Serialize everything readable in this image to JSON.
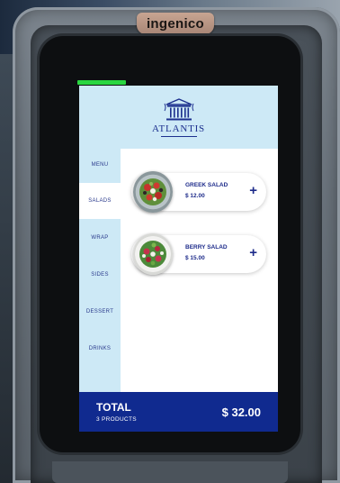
{
  "device": {
    "brand": "ingenico"
  },
  "logo": {
    "name": "ATLANTIS",
    "icon": "temple-icon"
  },
  "categories": [
    {
      "label": "MENU",
      "active": false
    },
    {
      "label": "SALADS",
      "active": true
    },
    {
      "label": "WRAP",
      "active": false
    },
    {
      "label": "SIDES",
      "active": false
    },
    {
      "label": "DESSERT",
      "active": false
    },
    {
      "label": "DRINKS",
      "active": false
    }
  ],
  "products": [
    {
      "name": "GREEK SALAD",
      "price": "$ 12.00",
      "add_label": "+",
      "icon": "salad-image"
    },
    {
      "name": "BERRY SALAD",
      "price": "$ 15.00",
      "add_label": "+",
      "icon": "salad-image"
    }
  ],
  "footer": {
    "total_label": "TOTAL",
    "count_label": "3 PRODUCTS",
    "amount": "$ 32.00"
  },
  "colors": {
    "accent": "#102a8f",
    "panel": "#cde9f6",
    "text_primary": "#1d2b8a",
    "status_led": "#29d640"
  }
}
